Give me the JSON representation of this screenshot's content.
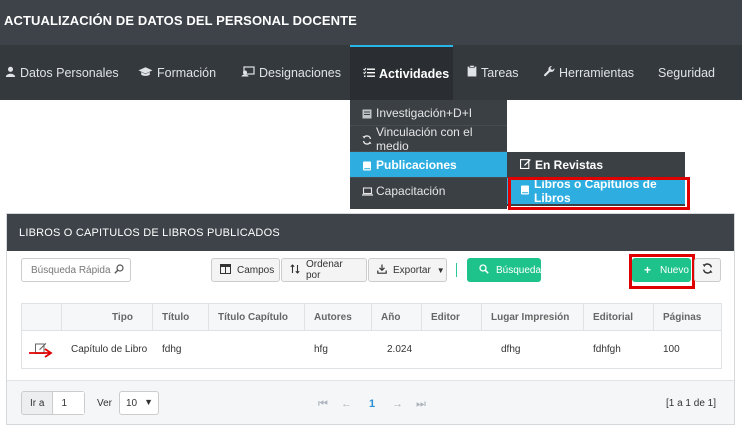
{
  "header": {
    "title": "ACTUALIZACIÓN DE DATOS DEL PERSONAL DOCENTE"
  },
  "nav": {
    "items": [
      {
        "label": "Datos Personales",
        "icon": "user-icon"
      },
      {
        "label": "Formación",
        "icon": "graduation-cap-icon"
      },
      {
        "label": "Designaciones",
        "icon": "designations-icon"
      },
      {
        "label": "Actividades",
        "icon": "list-check-icon",
        "active": true
      },
      {
        "label": "Tareas",
        "icon": "clipboard-icon"
      },
      {
        "label": "Herramientas",
        "icon": "wrench-icon"
      },
      {
        "label": "Seguridad",
        "icon": ""
      }
    ]
  },
  "dropdown": {
    "items": [
      {
        "label": "Investigación+D+I",
        "icon": "research-icon"
      },
      {
        "label": "Vinculación con el medio",
        "icon": "refresh-icon"
      },
      {
        "label": "Publicaciones",
        "icon": "book-icon",
        "active": true
      },
      {
        "label": "Capacitación",
        "icon": "laptop-icon"
      }
    ]
  },
  "submenu": {
    "items": [
      {
        "label": "En Revistas",
        "icon": "edit-icon"
      },
      {
        "label": "Libros o Capítulos de Libros",
        "icon": "book-icon",
        "active": true
      }
    ]
  },
  "panel": {
    "title": "LIBROS O CAPITULOS DE LIBROS PUBLICADOS",
    "search_placeholder": "Búsqueda Rápida",
    "toolbar": {
      "campos": "Campos",
      "ordenar": "Ordenar por",
      "exportar": "Exportar",
      "busqueda": "Búsqueda",
      "nuevo": "Nuevo"
    },
    "columns": [
      "Tipo",
      "Título",
      "Título Capítulo",
      "Autores",
      "Año",
      "Editor",
      "Lugar Impresión",
      "Editorial",
      "Páginas"
    ],
    "rows": [
      [
        "Capítulo de Libro",
        "fdhg",
        "",
        "hfg",
        "2.024",
        "",
        "dfhg",
        "fdhfgh",
        "100"
      ]
    ],
    "footer": {
      "go_label": "Ir a",
      "go_value": "1",
      "view_label": "Ver",
      "page_size": "10",
      "current_page": "1",
      "page_info": "[1 a 1 de 1]"
    }
  },
  "colors": {
    "accent": "#2eaee0",
    "header": "#3d4349",
    "green": "#1ec38b",
    "highlight": "#e00000"
  }
}
